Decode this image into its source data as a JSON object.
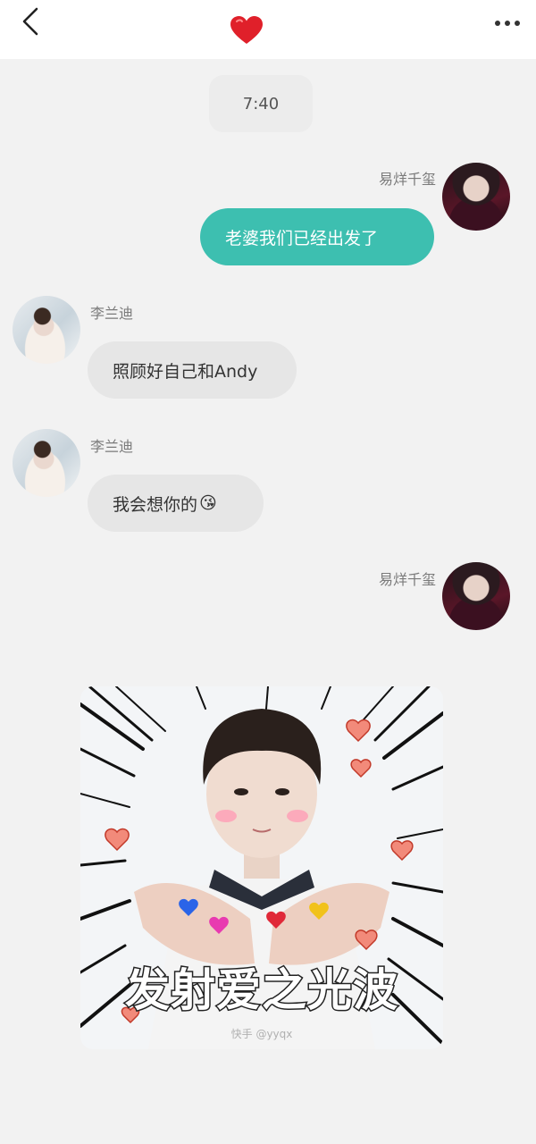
{
  "header": {
    "back_icon": "chevron-left-icon",
    "title_icon": "heart-icon",
    "more_icon": "more-horizontal-icon",
    "heart_color": "#e0202a"
  },
  "chat": {
    "timestamp": "7:40",
    "messages": [
      {
        "sender": "易烊千玺",
        "side": "right",
        "text": "老婆我们已经出发了"
      },
      {
        "sender": "李兰迪",
        "side": "left",
        "text": "照顾好自己和Andy"
      },
      {
        "sender": "李兰迪",
        "side": "left",
        "text": "我会想你的",
        "emoji": "😘"
      },
      {
        "sender": "易烊千玺",
        "side": "right",
        "sticker_caption": "发射爱之光波",
        "sticker_watermark": "快手 @yyqx"
      }
    ],
    "bubble_out_color": "#3dbfb0",
    "bubble_in_color": "#e6e6e6"
  }
}
